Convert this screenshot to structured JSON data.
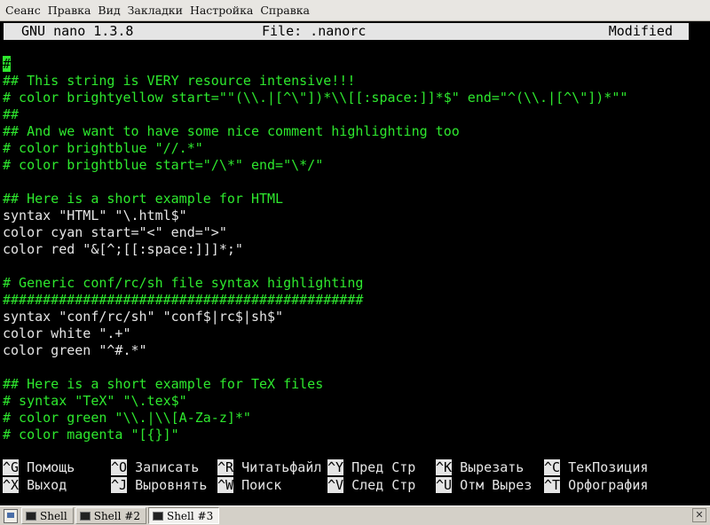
{
  "menubar": {
    "items": [
      "Сеанс",
      "Правка",
      "Вид",
      "Закладки",
      "Настройка",
      "Справка"
    ]
  },
  "nano": {
    "version": "GNU nano 1.3.8",
    "file": "File: .nanorc",
    "status": "Modified"
  },
  "editor": {
    "lines": [
      {
        "text": "#",
        "type": "comment",
        "cursor_first": true
      },
      {
        "text": "## This string is VERY resource intensive!!!",
        "type": "comment"
      },
      {
        "text": "# color brightyellow start=\"\"(\\\\.|[^\\\"])*\\\\[[:space:]]*$\" end=\"^(\\\\.|[^\\\"])*\"\"",
        "type": "comment"
      },
      {
        "text": "##",
        "type": "comment"
      },
      {
        "text": "## And we want to have some nice comment highlighting too",
        "type": "comment"
      },
      {
        "text": "# color brightblue \"//.*\"",
        "type": "comment"
      },
      {
        "text": "# color brightblue start=\"/\\*\" end=\"\\*/\"",
        "type": "comment"
      },
      {
        "text": "",
        "type": "normal"
      },
      {
        "text": "## Here is a short example for HTML",
        "type": "comment"
      },
      {
        "text": "syntax \"HTML\" \"\\.html$\"",
        "type": "normal"
      },
      {
        "text": "color cyan start=\"<\" end=\">\"",
        "type": "normal"
      },
      {
        "text": "color red \"&[^;[[:space:]]]*;\"",
        "type": "normal"
      },
      {
        "text": "",
        "type": "normal"
      },
      {
        "text": "# Generic conf/rc/sh file syntax highlighting",
        "type": "comment"
      },
      {
        "text": "#############################################",
        "type": "comment"
      },
      {
        "text": "syntax \"conf/rc/sh\" \"conf$|rc$|sh$\"",
        "type": "normal"
      },
      {
        "text": "color white \".+\"",
        "type": "normal"
      },
      {
        "text": "color green \"^#.*\"",
        "type": "normal"
      },
      {
        "text": "",
        "type": "normal"
      },
      {
        "text": "## Here is a short example for TeX files",
        "type": "comment"
      },
      {
        "text": "# syntax \"TeX\" \"\\.tex$\"",
        "type": "comment"
      },
      {
        "text": "# color green \"\\\\.|\\\\[A-Za-z]*\"",
        "type": "comment"
      },
      {
        "text": "# color magenta \"[{}]\"",
        "type": "comment"
      }
    ]
  },
  "shortcuts": {
    "row1": [
      {
        "key": "^G",
        "label": " Помощь"
      },
      {
        "key": "^O",
        "label": " Записать"
      },
      {
        "key": "^R",
        "label": " Читатьфайл"
      },
      {
        "key": "^Y",
        "label": " Пред Стр"
      },
      {
        "key": "^K",
        "label": " Вырезать"
      },
      {
        "key": "^C",
        "label": " ТекПозиция"
      }
    ],
    "row2": [
      {
        "key": "^X",
        "label": " Выход"
      },
      {
        "key": "^J",
        "label": " Выровнять"
      },
      {
        "key": "^W",
        "label": " Поиск"
      },
      {
        "key": "^V",
        "label": " След Стр"
      },
      {
        "key": "^U",
        "label": " Отм Вырез"
      },
      {
        "key": "^T",
        "label": " Орфография"
      }
    ]
  },
  "taskbar": {
    "tabs": [
      "Shell",
      "Shell #2",
      "Shell #3"
    ],
    "active_tab": 2,
    "icons": [
      "new-session-icon",
      "terminal-icon",
      "close-icon"
    ]
  },
  "colors": {
    "comment": "#2ee82e",
    "text": "#e5e5e5",
    "background": "#000000",
    "header": "#e5e5e5"
  }
}
